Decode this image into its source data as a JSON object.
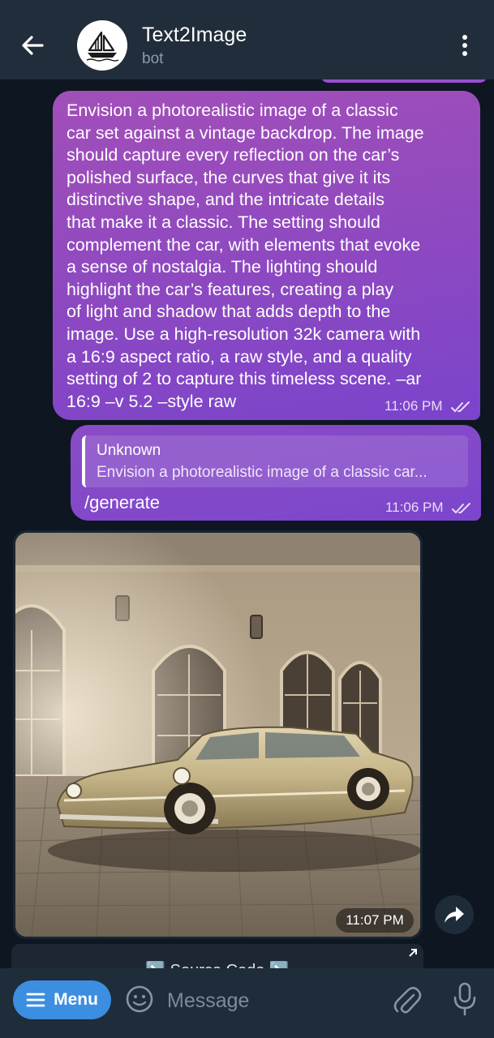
{
  "header": {
    "title": "Text2Image",
    "subtitle": "bot",
    "back_icon": "arrow-left-icon",
    "avatar_icon": "sailboat-logo-icon",
    "more_icon": "more-vertical-icon"
  },
  "messages": [
    {
      "type": "outgoing-text",
      "text": "Envision a photorealistic image of a classic\ncar set against a vintage backdrop. The image\nshould capture every reflection on the car’s\npolished surface, the curves that give it its\ndistinctive shape, and the intricate details\nthat make it a classic. The setting should\ncomplement the car, with elements that evoke\na sense of nostalgia. The lighting should\nhighlight the car’s features, creating a play\nof light and shadow that adds depth to the\nimage. Use a high-resolution 32k camera with\na 16:9 aspect ratio, a raw style, and a quality\nsetting of 2 to capture this timeless scene. –ar\n16:9 –v 5.2 –style raw",
      "time": "11:06 PM",
      "status": "read"
    },
    {
      "type": "outgoing-reply",
      "reply_to_name": "Unknown",
      "reply_to_text": "Envision a photorealistic image of a classic car...",
      "text": "/generate",
      "time": "11:06 PM",
      "status": "read"
    },
    {
      "type": "incoming-photo",
      "photo_description_icon": "classic-car-photo",
      "time": "11:07 PM",
      "share_icon": "forward-arrow-icon",
      "button_label": "↘️ Source Code ↘️"
    }
  ],
  "input_bar": {
    "menu_label": "Menu",
    "placeholder": "Message",
    "emoji_icon": "emoji-icon",
    "attach_icon": "paperclip-icon",
    "mic_icon": "microphone-icon"
  },
  "colors": {
    "header_bg": "#212d3b",
    "chat_bg": "#0e1621",
    "outgoing_bubble": "#8b48c2",
    "menu_button": "#3b8ee0"
  }
}
